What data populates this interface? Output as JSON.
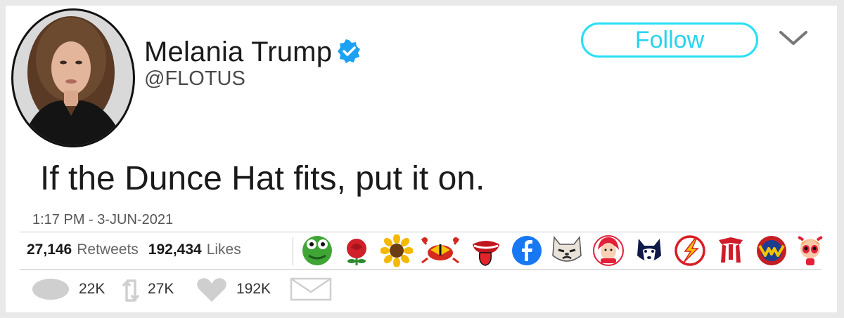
{
  "user": {
    "name": "Melania Trump",
    "handle": "@FLOTUS"
  },
  "follow_label": "Follow",
  "tweet": {
    "text": "If the Dunce Hat fits, put it on.",
    "timestamp": "1:17 PM - 3-JUN-2021"
  },
  "stats": {
    "retweets_count": "27,146",
    "retweets_label": "Retweets",
    "likes_count": "192,434",
    "likes_label": "Likes"
  },
  "actions": {
    "replies": "22K",
    "retweets": "27K",
    "likes": "192K"
  },
  "colors": {
    "follow": "#26d4ee",
    "verified": "#1da1f2",
    "icon_gray": "#cfcfcf"
  },
  "badge_icons": [
    "frog-icon",
    "rose-icon",
    "sunflower-icon",
    "maryland-crab-icon",
    "rolling-stones-tongue-icon",
    "facebook-icon",
    "grumpy-cat-icon",
    "wendys-logo-icon",
    "husky-icon",
    "flash-logo-icon",
    "spider-logo-icon",
    "wonder-woman-logo-icon",
    "powerpuff-girl-icon"
  ]
}
